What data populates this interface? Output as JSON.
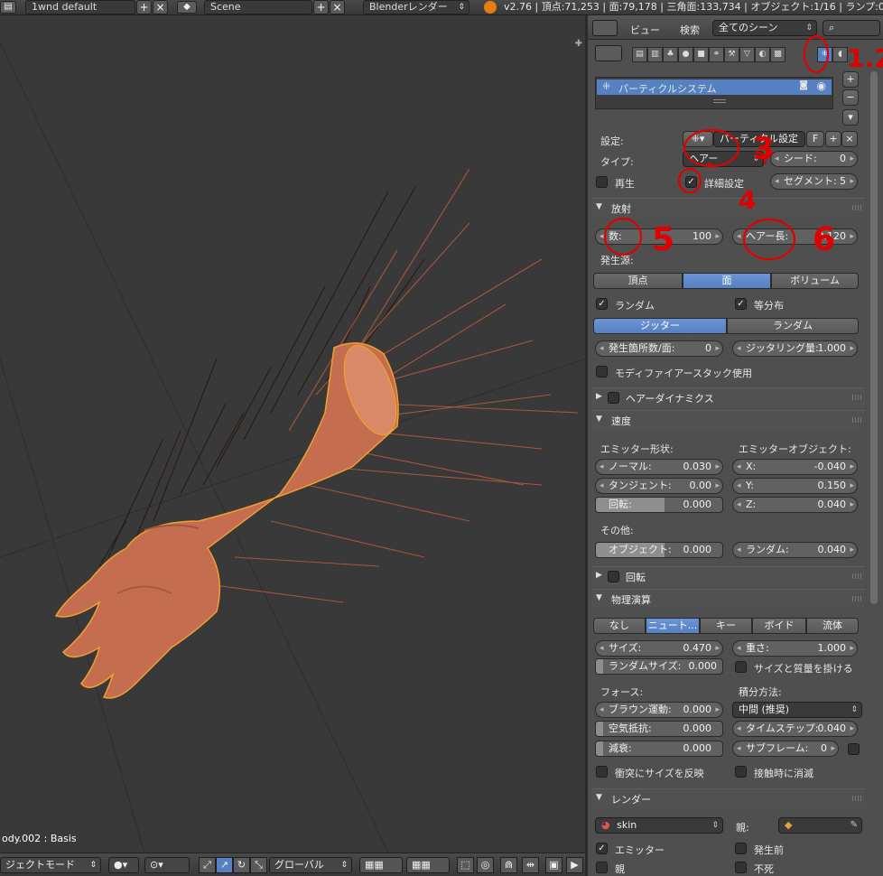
{
  "topbar": {
    "layout_name": "1wnd default",
    "scene_name": "Scene",
    "render_engine": "Blenderレンダー",
    "stats": "v2.76 | 頂点:71,253 | 面:79,178 | 三角面:133,734 | オブジェクト:1/16 | ランプ:0"
  },
  "viewport": {
    "object_label": "ody.002 : Basis"
  },
  "bottombar": {
    "mode": "ジェクトモード",
    "orientation": "グローバル"
  },
  "panel_header": {
    "view_menu": "ビュー",
    "search_menu": "検索",
    "scene_filter": "全てのシーン"
  },
  "particle_list": {
    "item_name": "パーティクルシステム"
  },
  "settings": {
    "settings_label": "設定:",
    "settings_name": "パーティクル設定",
    "fake_user": "F",
    "type_label": "タイプ:",
    "type_value": "ヘアー",
    "seed_label": "シード:",
    "seed_value": "0",
    "play_label": "再生",
    "advanced_label": "詳細設定",
    "segments_label": "セグメント:",
    "segments_value": "5"
  },
  "emission": {
    "title": "放射",
    "count_label": "数:",
    "count_value": "100",
    "hair_length_label": "ヘアー長:",
    "hair_length_value": "0.120",
    "emit_from_label": "発生源:",
    "emit_from_options": [
      "頂点",
      "面",
      "ボリューム"
    ],
    "random_label": "ランダム",
    "even_label": "等分布",
    "dist_options": [
      "ジッター",
      "ランダム"
    ],
    "per_face_label": "発生箇所数/面:",
    "per_face_value": "0",
    "jitter_amount_label": "ジッタリング量:",
    "jitter_amount_value": "1.000",
    "modifier_stack_label": "モディファイアースタック使用"
  },
  "hair_dynamics": {
    "title": "ヘアーダイナミクス"
  },
  "velocity": {
    "title": "速度",
    "emitter_geom_label": "エミッター形状:",
    "emitter_obj_label": "エミッターオブジェクト:",
    "normal_label": "ノーマル:",
    "normal_value": "0.030",
    "tangent_label": "タンジェント:",
    "tangent_value": "0.00",
    "rotation_label": "回転:",
    "rotation_value": "0.000",
    "x_label": "X:",
    "x_value": "-0.040",
    "y_label": "Y:",
    "y_value": "0.150",
    "z_label": "Z:",
    "z_value": "0.040",
    "other_label": "その他:",
    "object_label": "オブジェクト:",
    "object_value": "0.000",
    "random_label": "ランダム:",
    "random_value": "0.040"
  },
  "rotation_section": {
    "title": "回転"
  },
  "physics": {
    "title": "物理演算",
    "tabs": [
      "なし",
      "ニュート...",
      "キー",
      "ボイド",
      "流体"
    ],
    "size_label": "サイズ:",
    "size_value": "0.470",
    "mass_label": "重さ:",
    "mass_value": "1.000",
    "random_size_label": "ランダムサイズ:",
    "random_size_value": "0.000",
    "multiply_mass_label": "サイズと質量を掛ける",
    "forces_label": "フォース:",
    "integration_label": "積分方法:",
    "brownian_label": "ブラウン運動:",
    "brownian_value": "0.000",
    "integration_value": "中間 (推奨)",
    "drag_label": "空気抵抗:",
    "drag_value": "0.000",
    "timestep_label": "タイムステップ:",
    "timestep_value": "0.040",
    "damp_label": "減衰:",
    "damp_value": "0.000",
    "subframes_label": "サブフレーム:",
    "subframes_value": "0",
    "size_deflect_label": "衝突にサイズを反映",
    "die_on_hit_label": "接触時に消滅"
  },
  "render": {
    "title": "レンダー",
    "material": "skin",
    "parent_label": "親:",
    "emitter_label": "エミッター",
    "unborn_label": "発生前",
    "parents_label": "親",
    "died_label": "不死"
  },
  "annotations": [
    "1.2",
    "3",
    "4",
    "5",
    "6"
  ],
  "colors": {
    "accent": "#5680c2",
    "panel_bg": "#4f4f4f",
    "viewport_bg": "#393939",
    "hand_skin": "#c46e4f",
    "selection_outline": "#f0a030",
    "annotation_ink": "#e00000"
  },
  "icons": [
    "editor-type-icon",
    "screen-layout-icon",
    "scene-icon",
    "blender-logo-icon",
    "search-icon",
    "particles-icon",
    "eye-icon",
    "camera-icon",
    "material-sphere-icon",
    "eyedropper-icon",
    "cube-icon"
  ]
}
